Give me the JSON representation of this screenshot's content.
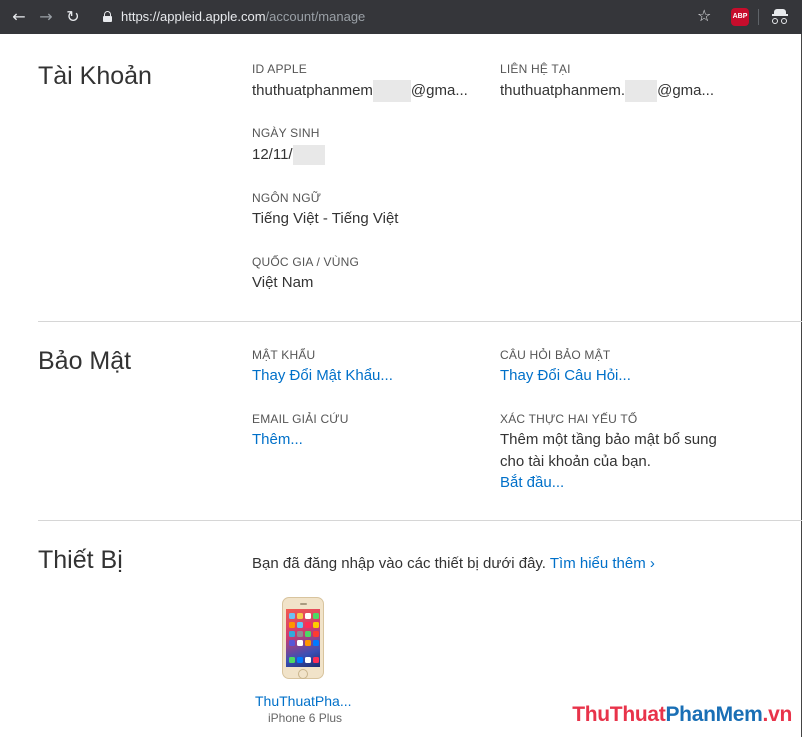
{
  "browser": {
    "back_icon": "arrow-left-icon",
    "forward_icon": "arrow-right-icon",
    "reload_icon": "reload-icon",
    "url_host": "https://appleid.apple.com",
    "url_path": "/account/manage",
    "abp_label": "ABP"
  },
  "account": {
    "title": "Tài Khoản",
    "apple_id_label": "ID APPLE",
    "apple_id_value_start": "thuthuatphanmem",
    "apple_id_value_end": "@gma...",
    "contact_label": "LIÊN HỆ TẠI",
    "contact_value_start": "thuthuatphanmem.",
    "contact_value_end": "@gma...",
    "birthday_label": "NGÀY SINH",
    "birthday_value": "12/11/",
    "language_label": "NGÔN NGỮ",
    "language_value": "Tiếng Việt - Tiếng Việt",
    "country_label": "QUỐC GIA / VÙNG",
    "country_value": "Việt Nam"
  },
  "security": {
    "title": "Bảo Mật",
    "password_label": "MẬT KHẨU",
    "password_link": "Thay Đổi Mật Khẩu...",
    "questions_label": "CÂU HỎI BẢO MẬT",
    "questions_link": "Thay Đổi Câu Hỏi...",
    "rescue_label": "EMAIL GIẢI CỨU",
    "rescue_link": "Thêm...",
    "twofa_label": "XÁC THỰC HAI YẾU TỐ",
    "twofa_desc_line1": "Thêm một tầng bảo mật bổ sung",
    "twofa_desc_line2": "cho tài khoản của bạn.",
    "twofa_link": "Bắt đầu..."
  },
  "devices": {
    "title": "Thiết Bị",
    "intro": "Bạn đã đăng nhập vào các thiết bị dưới đây.",
    "learn_more": "Tìm hiểu thêm ›",
    "items": [
      {
        "name": "ThuThuatPha...",
        "model": "iPhone 6 Plus"
      }
    ]
  },
  "watermark": {
    "part1": "ThuThuat",
    "part2": "PhanMem",
    "part3": ".vn",
    "color1": "#e8334a",
    "color2": "#1a6fb5"
  }
}
